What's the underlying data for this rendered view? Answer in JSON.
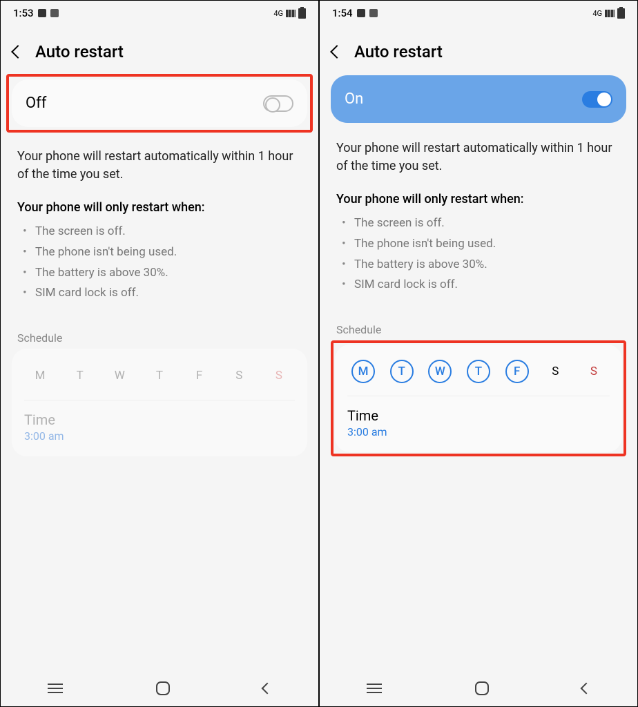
{
  "left": {
    "status_time": "1:53",
    "network_label": "4G",
    "title": "Auto restart",
    "toggle_label": "Off",
    "description": "Your phone will restart automatically within 1 hour of the time you set.",
    "conditions_heading": "Your phone will only restart when:",
    "conditions": [
      "The screen is off.",
      "The phone isn't being used.",
      "The battery is above 30%.",
      "SIM card lock is off."
    ],
    "schedule_label": "Schedule",
    "days": [
      "M",
      "T",
      "W",
      "T",
      "F",
      "S",
      "S"
    ],
    "time_label": "Time",
    "time_value": "3:00 am"
  },
  "right": {
    "status_time": "1:54",
    "network_label": "4G",
    "title": "Auto restart",
    "toggle_label": "On",
    "description": "Your phone will restart automatically within 1 hour of the time you set.",
    "conditions_heading": "Your phone will only restart when:",
    "conditions": [
      "The screen is off.",
      "The phone isn't being used.",
      "The battery is above 30%.",
      "SIM card lock is off."
    ],
    "schedule_label": "Schedule",
    "days": [
      "M",
      "T",
      "W",
      "T",
      "F",
      "S",
      "S"
    ],
    "selected_days": [
      true,
      true,
      true,
      true,
      true,
      false,
      false
    ],
    "time_label": "Time",
    "time_value": "3:00 am"
  }
}
